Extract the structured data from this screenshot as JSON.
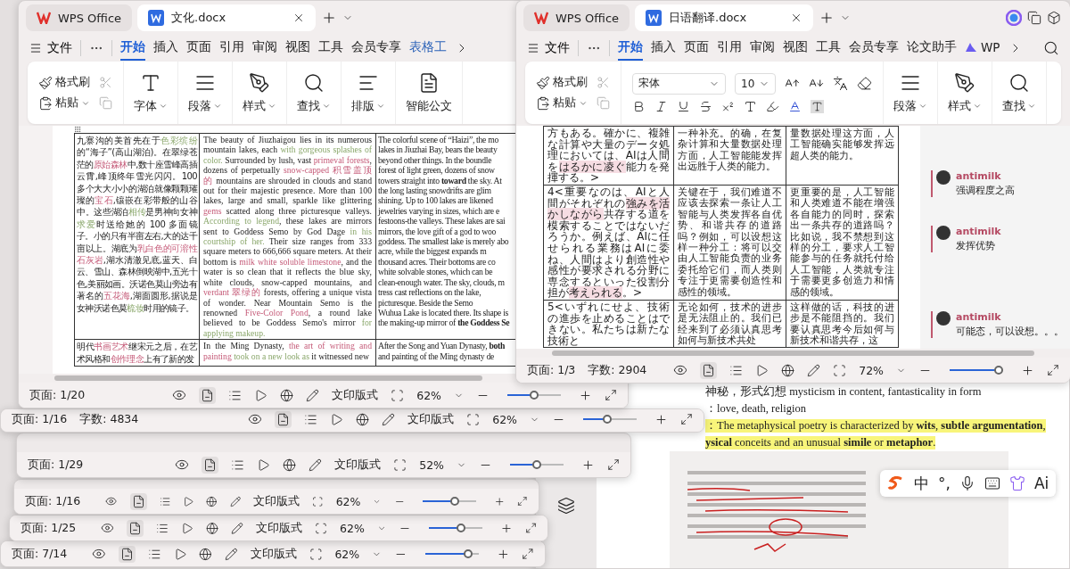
{
  "left_window": {
    "tabs": [
      {
        "label": "WPS Office",
        "kind": "home",
        "selected": false
      },
      {
        "label": "文化.docx",
        "kind": "doc",
        "selected": true
      }
    ],
    "file_menu": "文件",
    "menu": [
      {
        "label": "开始",
        "kind": "tab",
        "selected": true
      },
      {
        "label": "插入",
        "kind": "tab",
        "selected": false
      },
      {
        "label": "页面",
        "kind": "tab",
        "selected": false
      },
      {
        "label": "引用",
        "kind": "tab",
        "selected": false
      },
      {
        "label": "审阅",
        "kind": "tab",
        "selected": false
      },
      {
        "label": "视图",
        "kind": "tab",
        "selected": false
      },
      {
        "label": "工具",
        "kind": "tab",
        "selected": false
      },
      {
        "label": "会员专享",
        "kind": "tab",
        "selected": false
      },
      {
        "label": "表格工",
        "kind": "context",
        "selected": false
      }
    ],
    "clipboard": [
      "格式刷",
      "粘贴"
    ],
    "groups": [
      {
        "label": "字体",
        "kind": "font"
      },
      {
        "label": "段落",
        "kind": "paragraph"
      },
      {
        "label": "样式",
        "kind": "style"
      },
      {
        "label": "查找",
        "kind": "find"
      },
      {
        "label": "排版",
        "kind": "layout"
      },
      {
        "label": "智能公文",
        "kind": "doc"
      }
    ],
    "table": [
      [
        {
          "kind": "runs",
          "runs": [
            {
              "text": "九寨沟的美首先在于",
              "kind": "plain"
            },
            {
              "text": "色彩缤纷",
              "kind": "green"
            },
            {
              "text": "的“海子”(高山湖泊)。在翠绿苍茫的",
              "kind": "plain"
            },
            {
              "text": "原始森林",
              "kind": "pink"
            },
            {
              "text": "中,数十座雪峰高插云霄,峰顶终年雪光闪闪。100 多个大大小小的湖泊就像颗颗璀璨的",
              "kind": "plain"
            },
            {
              "text": "宝石",
              "kind": "pink"
            },
            {
              "text": ",镶嵌在彩带般的山谷中。这些湖泊",
              "kind": "plain"
            },
            {
              "text": "相传",
              "kind": "green"
            },
            {
              "text": "是男神向女神",
              "kind": "plain"
            },
            {
              "text": "求爱",
              "kind": "green"
            },
            {
              "text": "时送给她的 100 多面镜子。小的只有半亩左右,大的达千亩以上。湖底为",
              "kind": "plain"
            },
            {
              "text": "乳白色的可溶性石灰岩",
              "kind": "pink"
            },
            {
              "text": ",湖水清澈见底,蓝天、白云、雪山、森林倒映湖中,五光十色,美丽如画。沃诺色莫山旁边有著名的",
              "kind": "plain"
            },
            {
              "text": "五花海",
              "kind": "pink"
            },
            {
              "text": ",湖面圆形,据说是女神沃诺色莫",
              "kind": "plain"
            },
            {
              "text": "梳妆",
              "kind": "green"
            },
            {
              "text": "时用的镜子。",
              "kind": "plain"
            }
          ]
        },
        {
          "kind": "runs",
          "runs": [
            {
              "text": "The beauty of Jiuzhaigou lies in its numerous mountain lakes, each ",
              "kind": "plain"
            },
            {
              "text": "with gorgeous splashes of color.",
              "kind": "green"
            },
            {
              "text": " Surrounded by lush, vast ",
              "kind": "plain"
            },
            {
              "text": "primeval forests",
              "kind": "pink"
            },
            {
              "text": ", dozens of perpetually ",
              "kind": "plain"
            },
            {
              "text": "snow-capped 积雪盖顶的",
              "kind": "pink"
            },
            {
              "text": " mountains are shrouded in clouds and stand out for their majestic presence. More than 100 lakes, large and small, sparkle like glittering ",
              "kind": "plain"
            },
            {
              "text": "gems",
              "kind": "pink"
            },
            {
              "text": " scatted along three picturesque valleys. ",
              "kind": "plain"
            },
            {
              "text": "According to legend",
              "kind": "green"
            },
            {
              "text": ", these lakes are mirrors sent to Goddess Semo by God Dage ",
              "kind": "plain"
            },
            {
              "text": "in his courtship of her.",
              "kind": "green"
            },
            {
              "text": " Their size ranges from 333 square meters to 666,666 square meters. At their bottom is ",
              "kind": "plain"
            },
            {
              "text": "milk white soluble limestone",
              "kind": "pink"
            },
            {
              "text": ", and the water is so clean that it reflects the blue sky, white clouds, snow-capped mountains, and ",
              "kind": "plain"
            },
            {
              "text": "verdant 翠绿的",
              "kind": "pink"
            },
            {
              "text": "  forests, offering a unique vista of wonder. Near Mountain Semo is the renowned ",
              "kind": "plain"
            },
            {
              "text": "Five-Color Pond",
              "kind": "pink"
            },
            {
              "text": ", a round lake believed to be Goddess Semo's mirror ",
              "kind": "plain"
            },
            {
              "text": "for applying makeup.",
              "kind": "green"
            }
          ]
        },
        {
          "kind": "lines",
          "lines": [
            "The colorful scene of “Haizi”, the mo",
            "lakes in Jiuzhai Bay, bears the beauty",
            "beyond other things. In the boundle",
            "forest of light green, dozens of snow",
            "towers straight into **toward** the sky. At",
            "the long lasting snowdrifts are glim",
            "shining. Up to 100 lakes are likened",
            "jewelries varying in sizes, which are e",
            "festoons-the valleys. These lakes are sai",
            "mirrors, the love gift of a god to woo",
            "goddess. The smallest lake is merely abo",
            "acre, while the biggest expands m",
            "thousand acres. Their bottoms are co",
            "white solvable stones, which can be",
            "clean-enough water. The sky, clouds, m",
            "tress cast reflections on the lake,",
            "picturesque. Beside the Semo",
            "Wuhua Lake is located there. Its shape is",
            "the making-up mirror of **the Goddess Se**"
          ]
        }
      ],
      [
        {
          "kind": "runs",
          "runs": [
            {
              "text": "明代",
              "kind": "plain"
            },
            {
              "text": "书画艺术",
              "kind": "pink"
            },
            {
              "text": "继宋元之后，在艺术风格和",
              "kind": "plain"
            },
            {
              "text": "创作理念",
              "kind": "pink"
            },
            {
              "text": "上有了新的发",
              "kind": "plain"
            }
          ]
        },
        {
          "kind": "runs",
          "runs": [
            {
              "text": "In the Ming Dynasty, ",
              "kind": "plain"
            },
            {
              "text": "the art of writing and painting",
              "kind": "pink"
            },
            {
              "text": " took on a new look as",
              "kind": "green"
            },
            {
              "text": " it witnessed new",
              "kind": "plain"
            }
          ]
        },
        {
          "kind": "lines",
          "lines": [
            "After the Song and Yuan Dynasty, **both**",
            "and painting of the Ming dynasty de"
          ]
        }
      ]
    ],
    "status": {
      "page": "页面: 1/20",
      "layout": "文印版式",
      "zoom": "62%",
      "level": 0.5
    }
  },
  "right_window": {
    "tabs": [
      {
        "label": "WPS Office",
        "kind": "home",
        "selected": false
      },
      {
        "label": "日语翻译.docx",
        "kind": "doc",
        "selected": true
      }
    ],
    "file_menu": "文件",
    "menu": [
      {
        "label": "开始",
        "kind": "tab",
        "selected": true
      },
      {
        "label": "插入",
        "kind": "tab",
        "selected": false
      },
      {
        "label": "页面",
        "kind": "tab",
        "selected": false
      },
      {
        "label": "引用",
        "kind": "tab",
        "selected": false
      },
      {
        "label": "审阅",
        "kind": "tab",
        "selected": false
      },
      {
        "label": "视图",
        "kind": "tab",
        "selected": false
      },
      {
        "label": "工具",
        "kind": "tab",
        "selected": false
      },
      {
        "label": "会员专享",
        "kind": "tab",
        "selected": false
      },
      {
        "label": "论文助手",
        "kind": "tab",
        "selected": false
      },
      {
        "label": "WP",
        "kind": "ai",
        "selected": false
      }
    ],
    "clipboard": [
      "格式刷",
      "粘贴"
    ],
    "font": "宋体",
    "size": "10",
    "groups": [
      {
        "label": "段落",
        "kind": "paragraph"
      },
      {
        "label": "样式",
        "kind": "style"
      },
      {
        "label": "查找",
        "kind": "find"
      }
    ],
    "table": [
      [
        {
          "kind": "runs",
          "runs": [
            {
              "text": "方もある。確かに、複雑な計算や大量のデータ処理においては、AIは人間を",
              "kind": "plain"
            },
            {
              "text": "はるかに凌ぐ",
              "kind": "marked"
            },
            {
              "text": "能力を発揮する。>",
              "kind": "plain"
            }
          ]
        },
        {
          "kind": "runs",
          "runs": [
            {
              "text": "一种补充。的确，在复杂计算和大量数据处理方面，人工智能能发挥出远胜于人类的能力。",
              "kind": "plain"
            }
          ]
        },
        {
          "kind": "runs",
          "runs": [
            {
              "text": "量数据处理这方面，人工智能确实能够发挥远超人类的能力。",
              "kind": "plain"
            }
          ]
        }
      ],
      [
        {
          "kind": "runs",
          "runs": [
            {
              "text": "4<重要なのは、AIと人間がそれぞれの",
              "kind": "plain"
            },
            {
              "text": "強みを活かしながら",
              "kind": "marked"
            },
            {
              "text": "共存する道を模索することではないだろうか。例えば、AIに任せられる業務はAIに委ね、人間はより創造性や感性が要求される分野に専念するといった役割分担が",
              "kind": "plain"
            },
            {
              "text": "考えられる",
              "kind": "marked"
            },
            {
              "text": "。>",
              "kind": "plain"
            }
          ]
        },
        {
          "kind": "runs",
          "runs": [
            {
              "text": "关键在于，我们难道不应该去探索一条让人工智能与人类发挥各自优势、和谐共存的道路吗？例如，可以设想这样一种分工：将可以交由人工智能负责的业务委托给它们，而人类则专注于更需要创造性和感性的领域。",
              "kind": "plain"
            }
          ]
        },
        {
          "kind": "runs",
          "runs": [
            {
              "text": "更重要的是，人工智能和人类难道不能在增强各自能力的同时，探索出一条共存的道路吗？比如说，我不禁想到这样的分工，要求人工智能参与的任务就托付给人工智能，人类就专注于需要更多创造力和情感的领域。",
              "kind": "plain"
            }
          ]
        }
      ],
      [
        {
          "kind": "runs",
          "runs": [
            {
              "text": "5<いずれにせよ、技術の進歩を止めることはできない。私たちは新たな技術と",
              "kind": "plain"
            }
          ]
        },
        {
          "kind": "runs",
          "runs": [
            {
              "text": "无论如何，技术的进步是无法阻止的。我们已经来到了必须认真思考如何与新技术共处",
              "kind": "plain"
            }
          ]
        },
        {
          "kind": "runs",
          "runs": [
            {
              "text": "这样做的话，科技的进步是不能阻挡的。我们要认真思考今后如何与新技术和谐共存，这",
              "kind": "plain"
            }
          ]
        }
      ]
    ],
    "comments": [
      {
        "author": "antimilk",
        "text": "强调程度之高"
      },
      {
        "author": "antimilk",
        "text": "发挥优势"
      },
      {
        "author": "antimilk",
        "text": "可能态，可以设想。。。"
      }
    ],
    "status": {
      "page": "页面: 1/3",
      "words": "字数: 2904",
      "zoom": "72%",
      "level": 0.92
    }
  },
  "back_windows": [
    {
      "page": "页面: 1/16",
      "words": "字数: 4834",
      "layout": "文印版式",
      "zoom": "62%",
      "level": 0.45
    },
    {
      "page": "页面: 1/29",
      "layout": "文印版式",
      "zoom": "52%",
      "level": 0.5
    },
    {
      "page": "页面: 1/16",
      "layout": "文印版式",
      "zoom": "62%",
      "level": 0.6
    },
    {
      "page": "页面: 1/25",
      "layout": "文印版式",
      "zoom": "62%",
      "level": 0.6
    },
    {
      "page": "页面: 7/14",
      "layout": "文印版式",
      "zoom": "62%",
      "level": 0.8
    }
  ],
  "notes_document": {
    "lines": [
      {
        "text": "神秘，形式幻想 mysticism in content, fantasticality in form",
        "highlight": false
      },
      {
        "text": "：love, death, religion",
        "highlight": false
      },
      {
        "text": "：The metaphysical poetry is characterized by **wits**, **subtle argumentation**,",
        "highlight": true
      },
      {
        "text": "**ysical** conceits and an unusual **simile** or **metaphor**.",
        "highlight": true
      }
    ]
  },
  "input_toolbar": {
    "punctuation": "°,",
    "language": "中",
    "ai": "Ai"
  }
}
